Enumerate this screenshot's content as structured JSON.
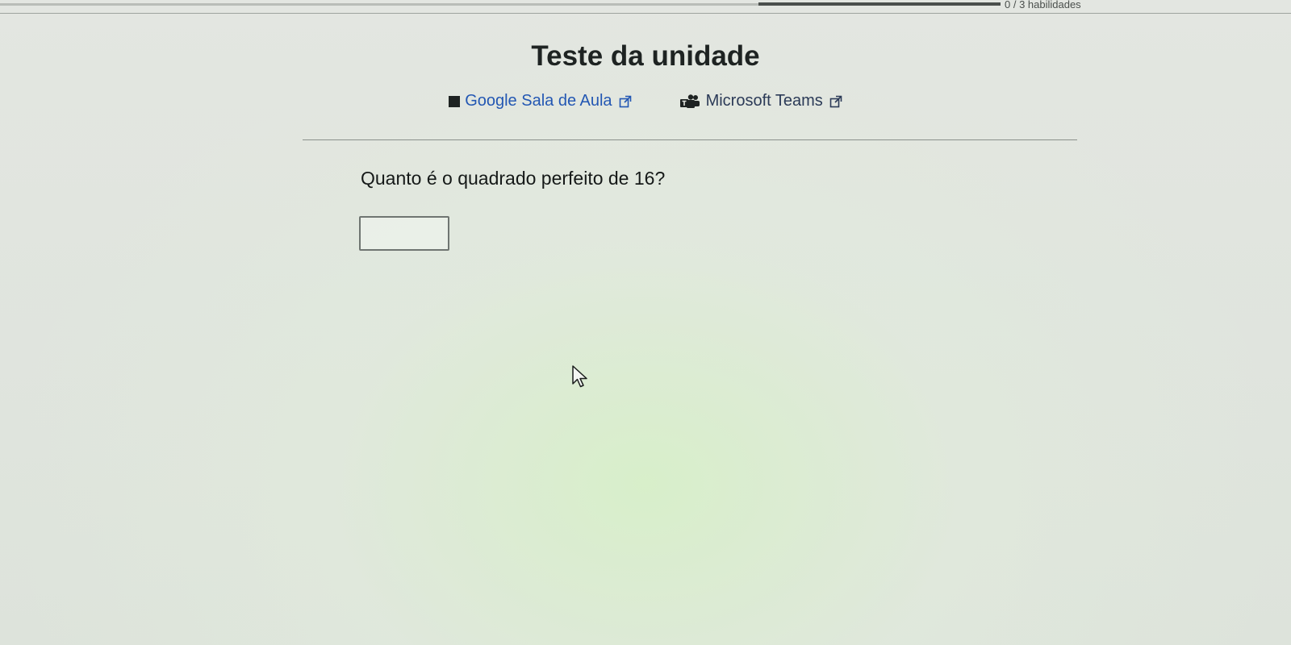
{
  "header": {
    "skills_progress": "0 / 3 habilidades",
    "progress_fraction": 0.0
  },
  "main": {
    "title": "Teste da unidade",
    "share_links": [
      {
        "label": "Google Sala de Aula",
        "icon": "google-classroom-icon",
        "ext_icon": "external-link-icon"
      },
      {
        "label": "Microsoft Teams",
        "icon": "microsoft-teams-icon",
        "ext_icon": "external-link-icon"
      }
    ],
    "question": "Quanto é o quadrado perfeito de 16?",
    "answer": {
      "value": "",
      "placeholder": ""
    }
  },
  "colors": {
    "link": "#2357b3",
    "text": "#151918",
    "border": "#6f7571"
  }
}
